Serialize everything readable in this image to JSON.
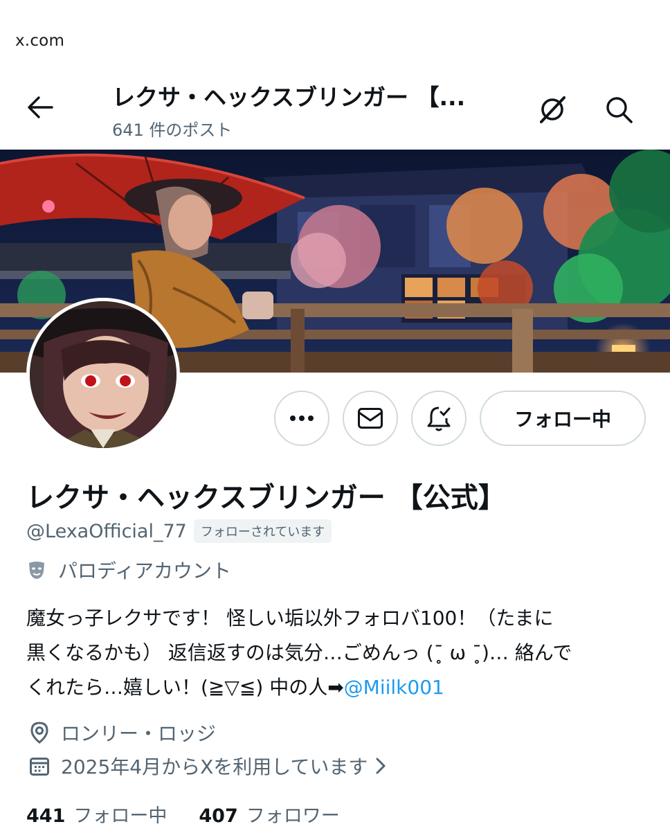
{
  "browser": {
    "url": "x.com"
  },
  "header": {
    "title": "レクサ・ヘックスブリンガー 【...",
    "post_count": "641 件のポスト",
    "back_icon": "arrow-left-icon",
    "grok_icon": "grok-icon",
    "search_icon": "search-icon"
  },
  "actions": {
    "more_icon": "more-dots-icon",
    "dm_icon": "envelope-icon",
    "notify_icon": "bell-check-icon",
    "follow_label": "フォロー中"
  },
  "profile": {
    "display_name": "レクサ・ヘックスブリンガー 【公式】",
    "handle": "@LexaOfficial_77",
    "follows_you": "フォローされています",
    "parody_label": "パロディアカウント",
    "bio_line1": "魔女っ子レクサです！ 怪しい垢以外フォロバ100！（たまに",
    "bio_line2": "黒くなるかも） 返信返すのは気分…ごめんっ (ˉ̥ ω ˉ̥)… 絡んで",
    "bio_line3": "くれたら…嬉しい！(≧▽≦) 中の人➡",
    "bio_mention": "@Miilk001",
    "location": "ロンリー・ロッジ",
    "joined": "2025年4月からXを利用しています"
  },
  "stats": {
    "following_count": "441",
    "following_label": "フォロー中",
    "followers_count": "407",
    "followers_label": "フォロワー"
  },
  "colors": {
    "accent": "#1d9bf0",
    "secondary_text": "#536471",
    "border": "#cfd9de"
  }
}
